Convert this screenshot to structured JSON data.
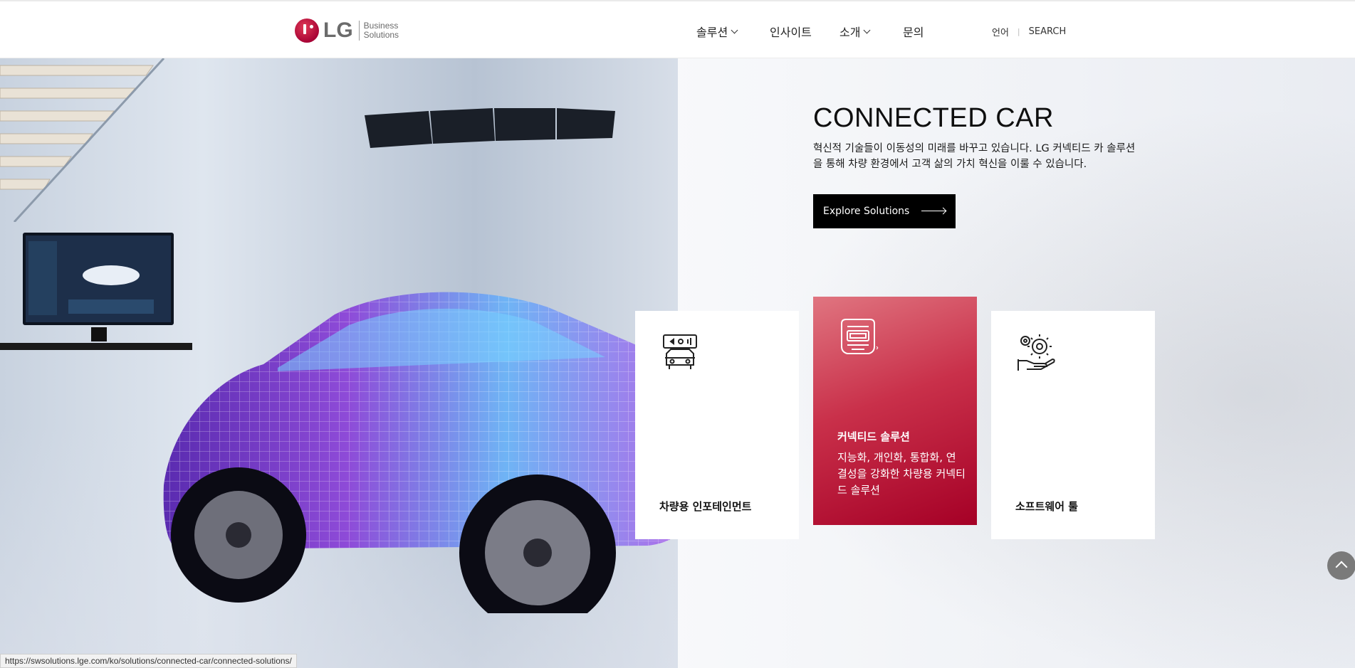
{
  "header": {
    "logo": {
      "brand": "LG",
      "sub_line1": "Business",
      "sub_line2": "Solutions"
    },
    "nav": [
      {
        "label": "솔루션",
        "has_dropdown": true
      },
      {
        "label": "인사이트",
        "has_dropdown": false
      },
      {
        "label": "소개",
        "has_dropdown": true
      },
      {
        "label": "문의",
        "has_dropdown": false
      }
    ],
    "language_label": "언어",
    "search_label": "SEARCH"
  },
  "hero": {
    "title": "CONNECTED CAR",
    "description": "혁신적 기술들이 이동성의 미래를 바꾸고 있습니다. LG 커넥티드 카 솔루션을 통해 차량 환경에서 고객 삶의 가치 혁신을 이룰 수 있습니다.",
    "cta_label": "Explore Solutions"
  },
  "cards": [
    {
      "title": "차량용 인포테인먼트",
      "icon": "car-infotainment-icon"
    },
    {
      "title": "커넥티드 솔루션",
      "description": "지능화, 개인화, 통합화, 연결성을 강화한 차량용 커넥티드 솔루션",
      "icon": "connected-device-icon",
      "active": true
    },
    {
      "title": "소프트웨어 툴",
      "icon": "software-gear-icon"
    }
  ],
  "status_bar_url": "https://swsolutions.lge.com/ko/solutions/connected-car/connected-solutions/",
  "colors": {
    "lg_red": "#a50034",
    "cta_bg": "#000000",
    "active_card_start": "#e07580",
    "active_card_end": "#a50026"
  }
}
